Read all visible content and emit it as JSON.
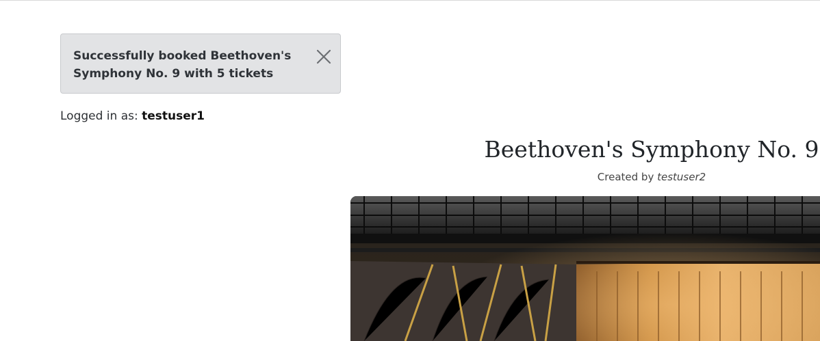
{
  "toast": {
    "message": "Successfully booked Beethoven's Symphony No. 9 with 5 tickets",
    "close_icon": "close-icon"
  },
  "session": {
    "prefix": "Logged in as:",
    "username": "testuser1"
  },
  "event": {
    "title": "Beethoven's Symphony No. 9",
    "created_by_label": "Created by",
    "creator": "testuser2",
    "image_subject": "concert-hall-photo"
  }
}
